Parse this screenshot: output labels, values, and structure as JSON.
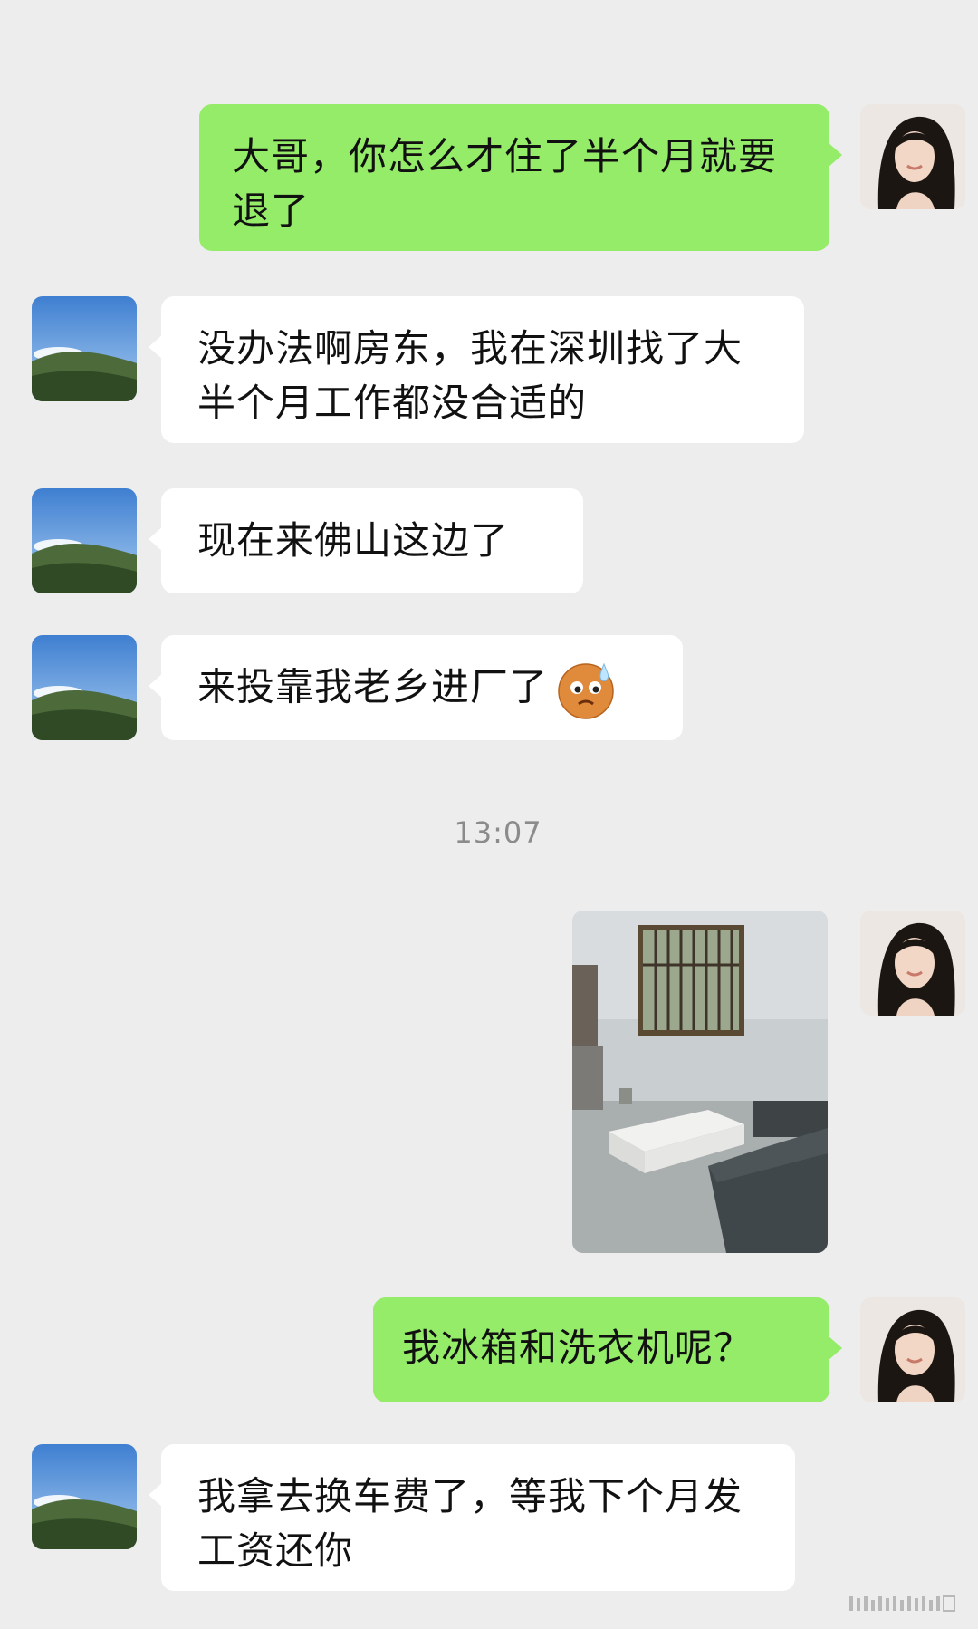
{
  "messages": [
    {
      "sender": "me",
      "text": "大哥，你怎么才住了半个月就要退了"
    },
    {
      "sender": "them",
      "text": "没办法啊房东，我在深圳找了大半个月工作都没合适的"
    },
    {
      "sender": "them",
      "text": "现在来佛山这边了"
    },
    {
      "sender": "them",
      "text": "来投靠我老乡进厂了",
      "emoji": "sweat-face-emoji"
    },
    {
      "sender": "me",
      "type": "image",
      "image": "room-photo"
    },
    {
      "sender": "me",
      "text": "我冰箱和洗衣机呢？"
    },
    {
      "sender": "them",
      "text": "我拿去换车费了，等我下个月发工资还你"
    }
  ],
  "timestamp": "13:07",
  "colors": {
    "background": "#ededed",
    "my_bubble": "#95ec69",
    "their_bubble": "#ffffff",
    "timestamp": "#8b8b8b"
  },
  "icons": {
    "my_avatar": "woman-portrait-avatar",
    "their_avatar": "mountain-sky-avatar",
    "emoji": "sweat-face-emoji",
    "watermark": "watermark-logo"
  }
}
